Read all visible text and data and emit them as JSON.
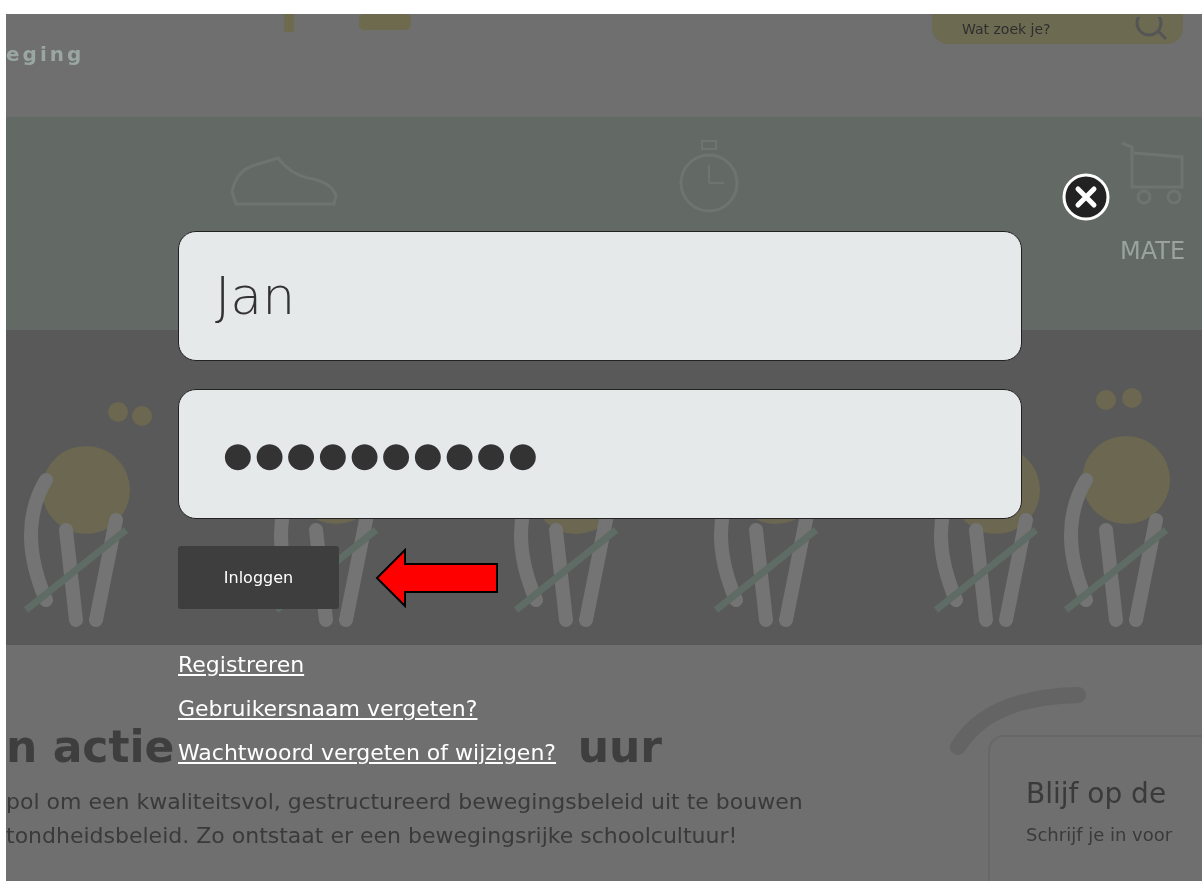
{
  "background": {
    "logo_text": "eging",
    "search": {
      "placeholder": "Wat zoek je?"
    },
    "nav_label": "MATE",
    "heading_parts": [
      "n actie",
      "uur"
    ],
    "paragraph_lines": [
      "pol om een kwaliteitsvol, gestructureerd bewegingsbeleid uit te bouwen",
      "tondheidsbeleid. Zo ontstaat er een bewegingsrijke schoolcultuur!"
    ],
    "card": {
      "title": "Blijf op de",
      "text": "Schrijf je in voor"
    }
  },
  "login_dialog": {
    "username": {
      "value": "Jan"
    },
    "password": {
      "value": "●●●●●●●●●●"
    },
    "login_button": "Inloggen",
    "links": [
      "Registreren",
      "Gebruikersnaam vergeten?",
      "Wachtwoord vergeten of wijzigen?"
    ]
  }
}
